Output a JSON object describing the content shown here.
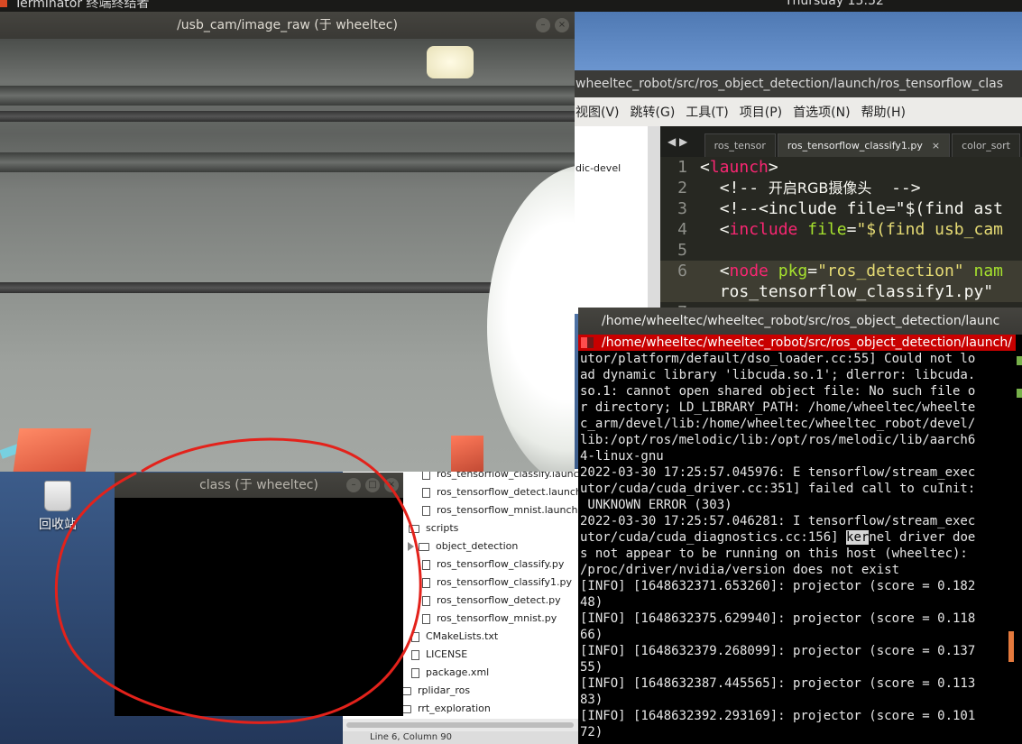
{
  "topbar": {
    "app_name": "Terminator 终端终结者",
    "clock": "Thursday 15:52"
  },
  "desktop": {
    "trash_label": "回收站"
  },
  "image_window": {
    "title": "/usb_cam/image_raw (于 wheeltec)",
    "buttons": [
      "–",
      "×"
    ]
  },
  "class_window": {
    "title": "class (于 wheeltec)",
    "buttons": [
      "–",
      "□",
      "×"
    ]
  },
  "editor": {
    "title": "wheeltec_robot/src/ros_object_detection/launch/ros_tensorflow_clas",
    "menu": [
      "视图(V)",
      "跳转(G)",
      "工具(T)",
      "项目(P)",
      "首选项(N)",
      "帮助(H)"
    ],
    "sidebar_label": "dic-devel",
    "tab_arrows": "◀ ▶",
    "tabs": [
      {
        "label": "ros_tensor"
      },
      {
        "label": "ros_tensorflow_classify1.py",
        "close": "×"
      },
      {
        "label": "color_sort"
      }
    ],
    "lines": [
      {
        "n": "1"
      },
      {
        "n": "2",
        "text": "开启RGB摄像头"
      },
      {
        "n": "3",
        "text": "<!--<include file=\"$(find ast"
      },
      {
        "n": "4"
      },
      {
        "n": "5"
      },
      {
        "n": "6"
      },
      {
        "n": ""
      },
      {
        "n": "7"
      }
    ],
    "line1_tag": "launch",
    "line2_open": "<!--",
    "line2_close": "-->",
    "line4_tag": "include",
    "line4_attr": "file",
    "line4_val": "\"$(find usb_cam",
    "line6_tag": "node",
    "line6_attr1": "pkg",
    "line6_val1": "\"ros_detection\"",
    "line6_attr2": "nam",
    "line6b_val": "ros_tensorflow_classify1.py\""
  },
  "filetree": {
    "items": [
      {
        "label": "ros_tensorflow_classify.launch"
      },
      {
        "label": "ros_tensorflow_detect.launch"
      },
      {
        "label": "ros_tensorflow_mnist.launch"
      },
      {
        "label": "scripts"
      },
      {
        "label": "object_detection"
      },
      {
        "label": "ros_tensorflow_classify.py"
      },
      {
        "label": "ros_tensorflow_classify1.py"
      },
      {
        "label": "ros_tensorflow_detect.py"
      },
      {
        "label": "ros_tensorflow_mnist.py"
      },
      {
        "label": "CMakeLists.txt"
      },
      {
        "label": "LICENSE"
      },
      {
        "label": "package.xml"
      },
      {
        "label": "rplidar_ros"
      },
      {
        "label": "rrt_exploration"
      }
    ],
    "status": "Line 6, Column 90"
  },
  "terminal": {
    "title": "/home/wheeltec/wheeltec_robot/src/ros_object_detection/launc",
    "tab_label": "/home/wheeltec/wheeltec_robot/src/ros_object_detection/launch/",
    "lines": [
      "utor/platform/default/dso_loader.cc:55] Could not lo",
      "ad dynamic library 'libcuda.so.1'; dlerror: libcuda.",
      "so.1: cannot open shared object file: No such file o",
      "r directory; LD_LIBRARY_PATH: /home/wheeltec/wheelte",
      "c_arm/devel/lib:/home/wheeltec/wheeltec_robot/devel/",
      "lib:/opt/ros/melodic/lib:/opt/ros/melodic/lib/aarch6",
      "4-linux-gnu",
      "2022-03-30 17:25:57.045976: E tensorflow/stream_exec",
      "utor/cuda/cuda_driver.cc:351] failed call to cuInit:",
      " UNKNOWN ERROR (303)",
      "2022-03-30 17:25:57.046281: I tensorflow/stream_exec",
      "utor/cuda/cuda_diagnostics.cc:156] ",
      "s not appear to be running on this host (wheeltec):",
      "/proc/driver/nvidia/version does not exist",
      "[INFO] [1648632371.653260]: projector (score = 0.182",
      "48)",
      "[INFO] [1648632375.629940]: projector (score = 0.118",
      "66)",
      "[INFO] [1648632379.268099]: projector (score = 0.137",
      "55)",
      "[INFO] [1648632387.445565]: projector (score = 0.113",
      "83)",
      "[INFO] [1648632392.293169]: projector (score = 0.101",
      "72)"
    ],
    "selected_word": "ker",
    "after_selected": "nel driver doe"
  }
}
